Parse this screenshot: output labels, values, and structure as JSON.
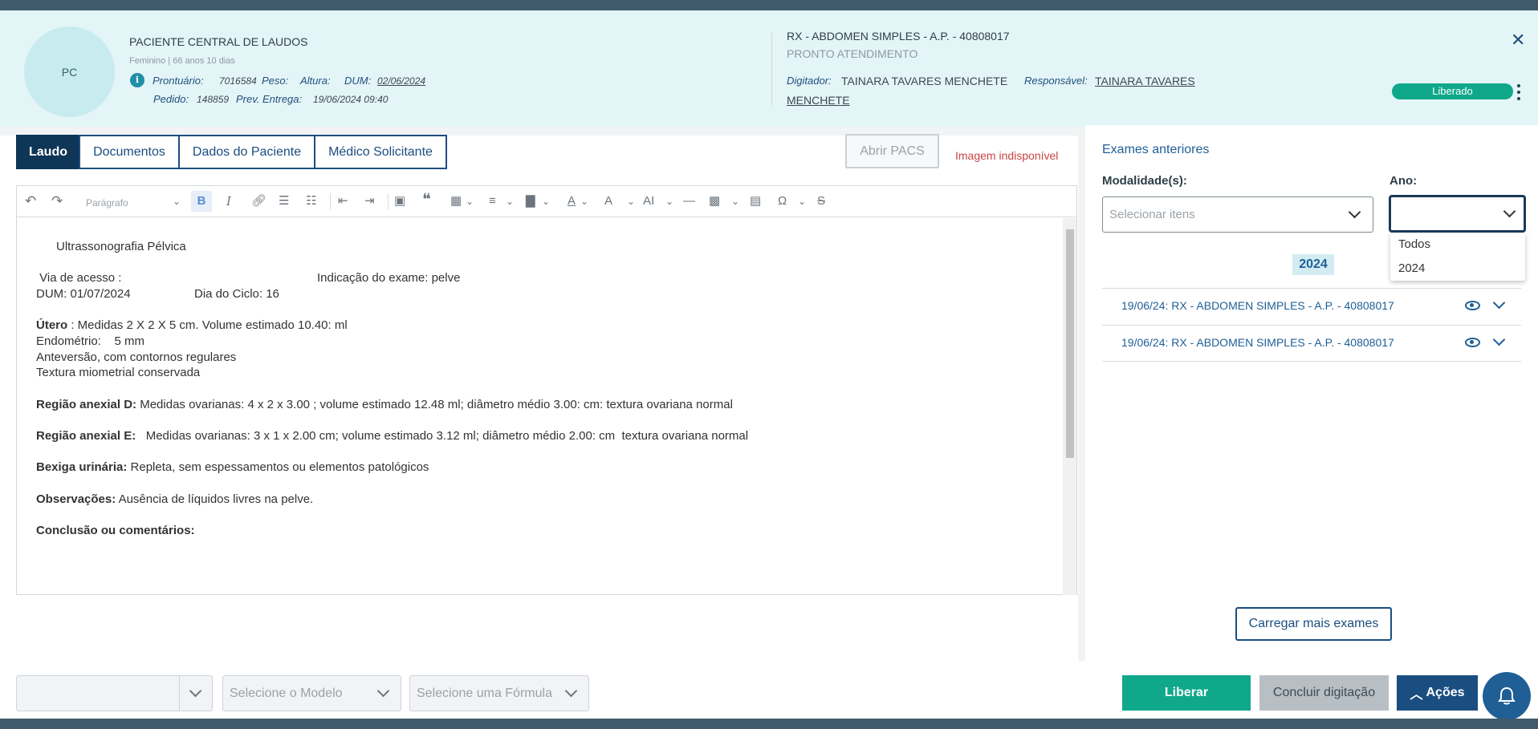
{
  "colors": {
    "primary": "#1b4e80",
    "success": "#0fa88b",
    "danger": "#c94444",
    "header_bg": "#e4f5f7"
  },
  "patient": {
    "initials": "PC",
    "name": "PACIENTE CENTRAL DE LAUDOS",
    "sub": "Feminino | 66 anos 10 dias",
    "prontuario_label": "Prontuário:",
    "prontuario": "7016584",
    "peso_label": "Peso:",
    "altura_label": "Altura:",
    "dum_label": "DUM:",
    "dum": "02/06/2024",
    "pedido_label": "Pedido:",
    "pedido": "148859",
    "prev_label": "Prev. Entrega:",
    "prev": "19/06/2024 09:40"
  },
  "exam": {
    "title": "RX - ABDOMEN SIMPLES - A.P. - 40808017",
    "sub": "PRONTO ATENDIMENTO",
    "digitador_label": "Digitador:",
    "digitador": "TAINARA TAVARES MENCHETE",
    "responsavel_label": "Responsável:",
    "responsavel_1": "TAINARA TAVARES",
    "responsavel_2": "MENCHETE",
    "status": "Liberado"
  },
  "tabs": [
    "Laudo",
    "Documentos",
    "Dados do Paciente",
    "Médico Solicitante"
  ],
  "pacs_button": "Abrir PACS",
  "image_unavailable": "Imagem indisponível",
  "editor": {
    "paragraph_select": "Parágrafo",
    "lines": {
      "title": "Ultrassonografia Pélvica",
      "via": " Via de acesso :",
      "indicacao": "Indicação do exame: pelve",
      "dum": "DUM: 01/07/2024",
      "ciclo": "Dia do Ciclo: 16",
      "utero_b": "Útero",
      "utero": " : Medidas 2 X 2 X 5 cm. Volume estimado 10.40: ml",
      "endometrio": "Endométrio:    5 mm",
      "anteversao": "Anteversão, com contornos regulares",
      "textura": "Textura miometrial conservada",
      "anexial_d_b": "Região anexial D:",
      "anexial_d": " Medidas ovarianas: 4 x 2 x 3.00 ; volume estimado 12.48 ml; diâmetro médio 3.00: cm: textura ovariana normal",
      "anexial_e_b": "Região anexial E:",
      "anexial_e": "   Medidas ovarianas: 3 x 1 x 2.00 cm; volume estimado 3.12 ml; diâmetro médio 2.00: cm  textura ovariana normal",
      "bexiga_b": "Bexiga urinária:",
      "bexiga": " Repleta, sem espessamentos ou elementos patológicos",
      "obs_b": "Observações:",
      "obs": " Ausência de líquidos livres na pelve.",
      "conclusao_b": "Conclusão ou comentários:"
    }
  },
  "previous": {
    "title": "Exames anteriores",
    "modalidade_label": "Modalidade(s):",
    "modalidade_placeholder": "Selecionar itens",
    "ano_label": "Ano:",
    "ano_options": [
      "Todos",
      "2024"
    ],
    "year_badge": "2024",
    "exams": [
      "19/06/24: RX - ABDOMEN SIMPLES - A.P. - 40808017",
      "19/06/24: RX - ABDOMEN SIMPLES - A.P. - 40808017"
    ],
    "load_more": "Carregar mais exames"
  },
  "footer": {
    "modelo_placeholder": "Selecione o Modelo",
    "formula_placeholder": "Selecione uma Fórmula",
    "liberar": "Liberar",
    "concluir": "Concluir digitação",
    "acoes": "Ações"
  }
}
